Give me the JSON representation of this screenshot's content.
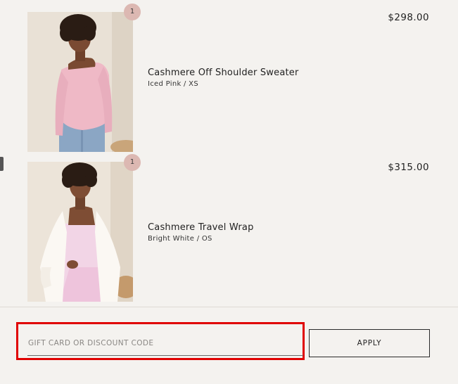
{
  "cart": {
    "items": [
      {
        "name": "Cashmere Off Shoulder Sweater",
        "variant": "Iced Pink / XS",
        "price": "$298.00",
        "quantity": "1"
      },
      {
        "name": "Cashmere Travel Wrap",
        "variant": "Bright White / OS",
        "price": "$315.00",
        "quantity": "1"
      }
    ]
  },
  "discount": {
    "placeholder": "GIFT CARD OR DISCOUNT CODE",
    "value": "",
    "apply_label": "APPLY",
    "highlight_color": "#e00000"
  },
  "colors": {
    "background": "#f4f2ef",
    "badge": "#dcb8b2"
  }
}
